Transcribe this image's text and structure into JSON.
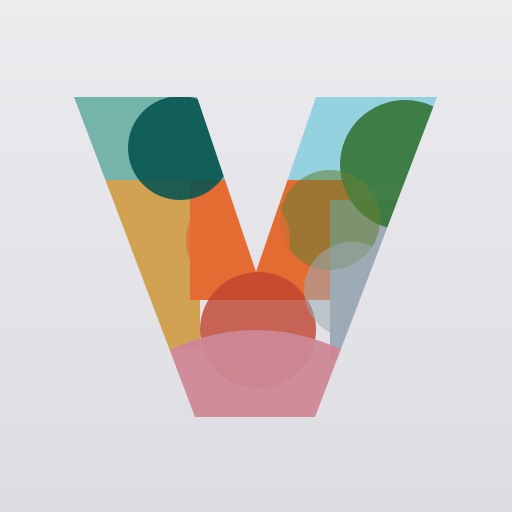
{
  "app_icon": {
    "icon": "letter-v-logo-icon",
    "background_colors": [
      "#ececef",
      "#dcdce2"
    ],
    "palette": {
      "teal": "#75b4ab",
      "dark_teal": "#05534f",
      "sky_blue": "#94d2e0",
      "mustard": "#d2a253",
      "orange": "#e46c32",
      "dark_green": "#39783d",
      "olive_green": "#647f35",
      "slate_gray": "#9cabb7",
      "rust_red": "#c1432f",
      "dusty_pink": "#cd8795"
    }
  }
}
